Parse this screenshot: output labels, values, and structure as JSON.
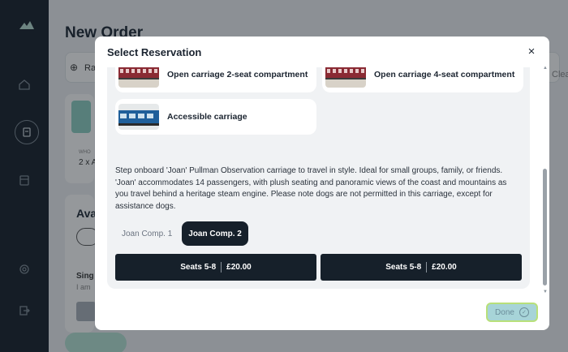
{
  "background": {
    "page_title": "New Order",
    "toolbar_fragment": "Ra",
    "clear_fragment": "Clea",
    "who_fragment": "WHO",
    "guests_fragment": "2 x A",
    "available_fragment": "Ava",
    "single_fragment": "Sing",
    "iam_fragment": "I am"
  },
  "modal": {
    "title": "Select Reservation",
    "close_icon": "×",
    "options": [
      {
        "label": "Open carriage 2-seat compartment",
        "icon": "train-thumbnail-red"
      },
      {
        "label": "Open carriage 4-seat compartment",
        "icon": "train-thumbnail-red"
      },
      {
        "label": "Accessible carriage",
        "icon": "train-thumbnail-blue"
      }
    ],
    "description": "Step onboard 'Joan' Pullman Observation carriage to travel in style. Ideal for small groups, family, or friends. 'Joan' accommodates 14 passengers, with plush seating and panoramic views of the coast and mountains as you travel behind a heritage steam engine. Please note dogs are not permitted in this carriage, except for assistance dogs.",
    "tabs": [
      {
        "label": "Joan Comp. 1",
        "active": false
      },
      {
        "label": "Joan Comp. 2",
        "active": true
      }
    ],
    "seats": [
      {
        "seats": "Seats 5-8",
        "price": "£20.00"
      },
      {
        "seats": "Seats 5-8",
        "price": "£20.00"
      }
    ],
    "done_label": "Done",
    "done_icon": "✓"
  },
  "colors": {
    "sidebar": "#16202a",
    "accent_dark": "#16202a",
    "done_bg": "#a7d4d8"
  }
}
